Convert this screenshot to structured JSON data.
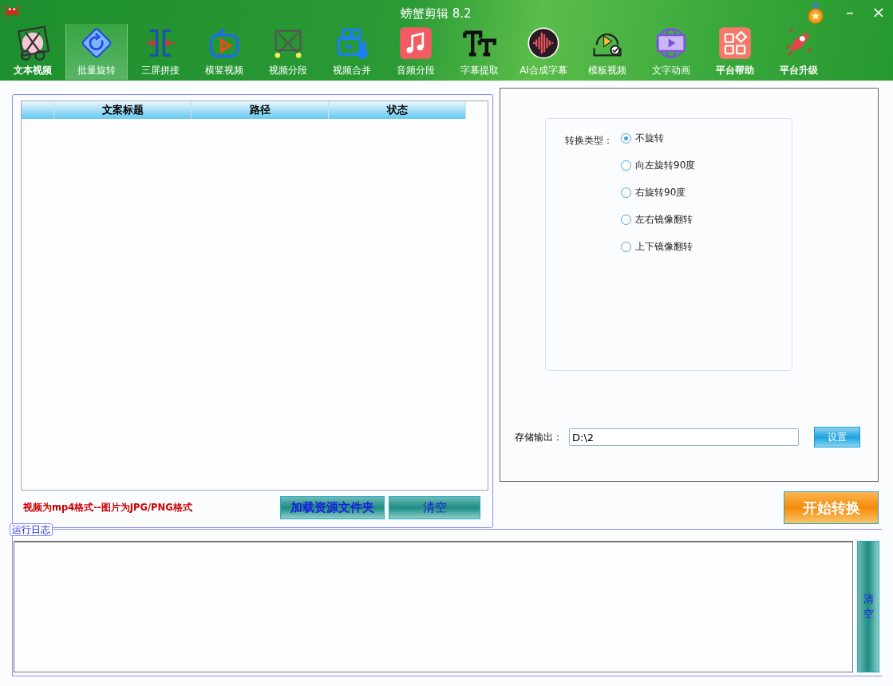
{
  "window": {
    "title": "螃蟹剪辑 8.2",
    "minimize": "–",
    "close": "×"
  },
  "toolbar": [
    {
      "label": "文本视频",
      "selected": false,
      "bold": true
    },
    {
      "label": "批量旋转",
      "selected": true,
      "bold": false
    },
    {
      "label": "三屏拼接",
      "selected": false,
      "bold": false
    },
    {
      "label": "横竖视频",
      "selected": false,
      "bold": false
    },
    {
      "label": "视频分段",
      "selected": false,
      "bold": false
    },
    {
      "label": "视频合并",
      "selected": false,
      "bold": false
    },
    {
      "label": "音频分段",
      "selected": false,
      "bold": false
    },
    {
      "label": "字幕提取",
      "selected": false,
      "bold": false
    },
    {
      "label": "AI合成字幕",
      "selected": false,
      "bold": false
    },
    {
      "label": "模板视频",
      "selected": false,
      "bold": false
    },
    {
      "label": "文字动画",
      "selected": false,
      "bold": false
    },
    {
      "label": "平台帮助",
      "selected": false,
      "bold": true
    },
    {
      "label": "平台升级",
      "selected": false,
      "bold": true
    }
  ],
  "table": {
    "columns": [
      "",
      "文案标题",
      "路径",
      "状态"
    ]
  },
  "format_note": "视频为mp4格式--图片为JPG/PNG格式",
  "load_button": "加载资源文件夹",
  "clear_button": "清空",
  "convert_type": {
    "label": "转换类型：",
    "options": [
      {
        "label": "不旋转",
        "selected": true
      },
      {
        "label": "向左旋转90度",
        "selected": false
      },
      {
        "label": "右旋转90度",
        "selected": false
      },
      {
        "label": "左右镜像翻转",
        "selected": false
      },
      {
        "label": "上下镜像翻转",
        "selected": false
      }
    ]
  },
  "output": {
    "label": "存储输出：",
    "value": "D:\\2",
    "button": "设置"
  },
  "start_button": "开始转换",
  "log": {
    "title": "运行日志",
    "clear_button": "清空"
  }
}
